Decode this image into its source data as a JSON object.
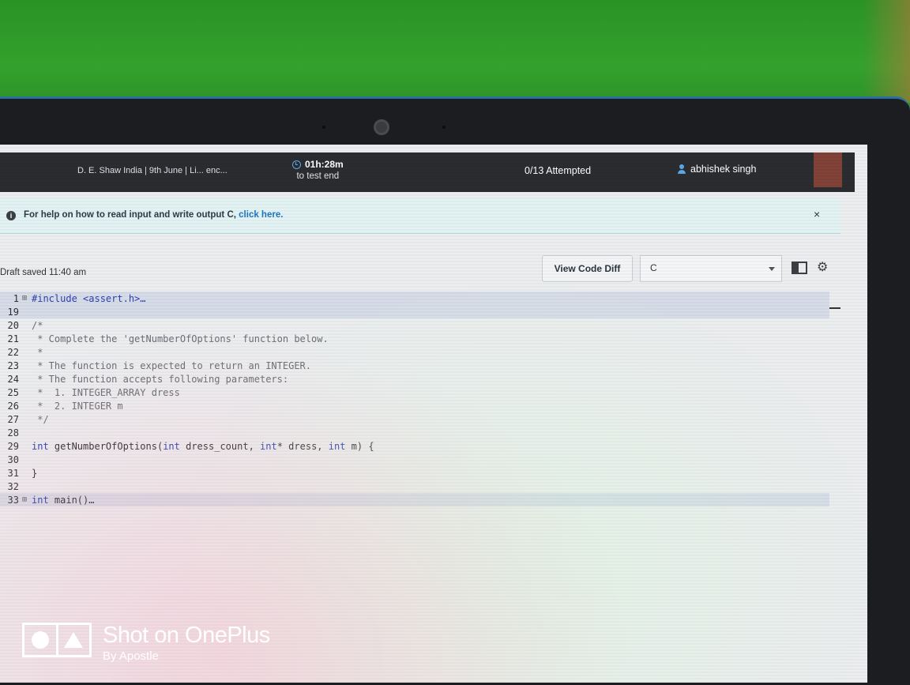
{
  "header": {
    "test_name": "D. E. Shaw India | 9th June | Li... enc...",
    "timer_value": "01h:28m",
    "timer_label": "to test end",
    "attempted": "0/13 Attempted",
    "user_name": "abhishek singh"
  },
  "banner": {
    "text": "For help on how to read input and write output ",
    "suffix": "C, ",
    "link": "click here."
  },
  "toolbar": {
    "draft_status": "Draft saved 11:40 am",
    "view_diff_label": "View Code Diff",
    "language": "C"
  },
  "code_lines": [
    {
      "num": "1",
      "text": "#include <assert.h>…",
      "fold": "⊞"
    },
    {
      "num": "19",
      "text": "",
      "fold": ""
    },
    {
      "num": "20",
      "text": "/*",
      "fold": ""
    },
    {
      "num": "21",
      "text": " * Complete the 'getNumberOfOptions' function below.",
      "fold": ""
    },
    {
      "num": "22",
      "text": " *",
      "fold": ""
    },
    {
      "num": "23",
      "text": " * The function is expected to return an INTEGER.",
      "fold": ""
    },
    {
      "num": "24",
      "text": " * The function accepts following parameters:",
      "fold": ""
    },
    {
      "num": "25",
      "text": " *  1. INTEGER_ARRAY dress",
      "fold": ""
    },
    {
      "num": "26",
      "text": " *  2. INTEGER m",
      "fold": ""
    },
    {
      "num": "27",
      "text": " */",
      "fold": ""
    },
    {
      "num": "28",
      "text": "",
      "fold": ""
    },
    {
      "num": "29",
      "text": "int getNumberOfOptions(int dress_count, int* dress, int m) {",
      "fold": ""
    },
    {
      "num": "30",
      "text": "",
      "fold": ""
    },
    {
      "num": "31",
      "text": "}",
      "fold": ""
    },
    {
      "num": "32",
      "text": "",
      "fold": ""
    },
    {
      "num": "33",
      "text": "int main()…",
      "fold": "⊞"
    }
  ],
  "watermark": {
    "title": "Shot on OnePlus",
    "subtitle": "By Apostle"
  },
  "icons": [
    "clock-icon",
    "user-icon",
    "info-icon",
    "close-icon",
    "chevron-down-icon",
    "layout-toggle-icon",
    "gear-icon"
  ]
}
